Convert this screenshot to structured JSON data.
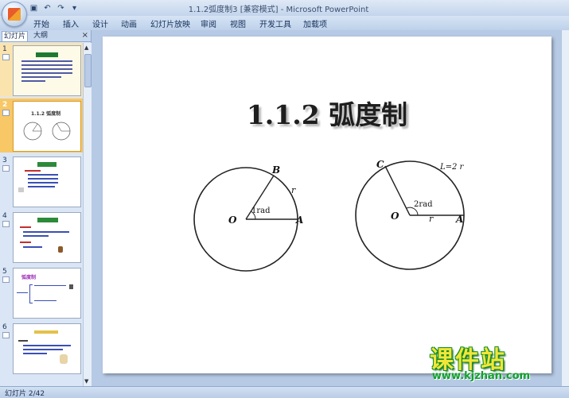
{
  "window": {
    "title": "1.1.2弧度制3 [兼容模式] - Microsoft PowerPoint"
  },
  "quick_access": {
    "save_icon": "save-icon",
    "undo_icon": "undo-icon",
    "redo_icon": "redo-icon"
  },
  "ribbon": {
    "tabs": [
      "开始",
      "插入",
      "设计",
      "动画",
      "幻灯片放映",
      "审阅",
      "视图",
      "开发工具",
      "加载项"
    ]
  },
  "left_panel": {
    "tab_slides": "幻灯片",
    "tab_outline": "大纲",
    "close": "×",
    "slides": [
      {
        "number": "1"
      },
      {
        "number": "2",
        "title": "1.1.2 弧度制"
      },
      {
        "number": "3"
      },
      {
        "number": "4"
      },
      {
        "number": "5",
        "label": "弧度制"
      },
      {
        "number": "6"
      }
    ]
  },
  "slide": {
    "title": "1.1.2 弧度制",
    "left_circle": {
      "center_label": "O",
      "point_a": "A",
      "point_b": "B",
      "radius_label": "r",
      "angle_label": "1rad"
    },
    "right_circle": {
      "center_label": "O",
      "point_a": "A",
      "point_c": "C",
      "radius_label": "r",
      "arc_label": "L=2 r",
      "angle_label": "2rad"
    }
  },
  "watermark": {
    "title": "课件站",
    "url": "www.kjzhan.com"
  },
  "status": {
    "slide_counter": "幻灯片 2/42"
  }
}
